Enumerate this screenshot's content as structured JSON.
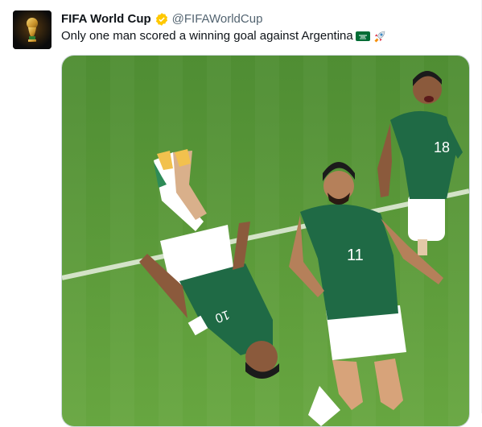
{
  "tweet": {
    "author_name": "FIFA World Cup",
    "author_handle": "@FIFAWorldCup",
    "text": "Only one man scored a winning goal against Argentina",
    "emojis": [
      "saudi-arabia-flag",
      "rocket"
    ]
  },
  "player_numbers": [
    "18",
    "11",
    "10"
  ],
  "colors": {
    "verified": "#ffc800",
    "text": "#0f1419",
    "handle": "#536471",
    "pitch": "#5c9a3a",
    "kit": "#1f6a45"
  }
}
